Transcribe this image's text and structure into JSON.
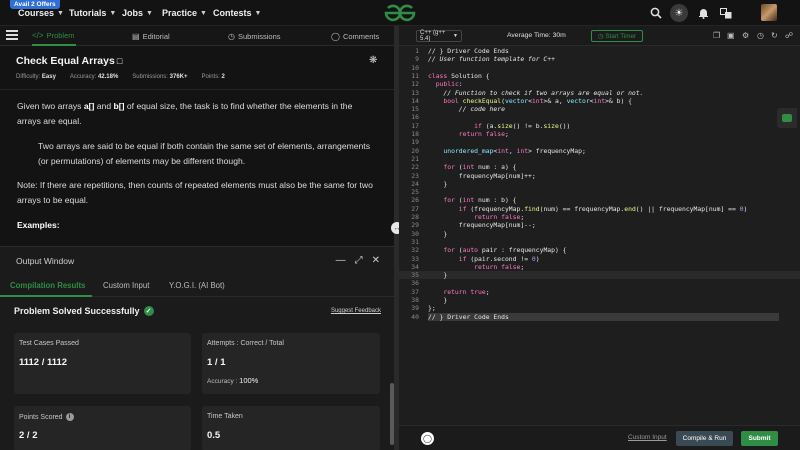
{
  "nav": {
    "offer_badge": "Avail 2 Offers",
    "items": [
      "Courses",
      "Tutorials",
      "Jobs",
      "Practice",
      "Contests"
    ]
  },
  "left_tabs": {
    "problem": "Problem",
    "editorial": "Editorial",
    "submissions": "Submissions",
    "comments": "Comments"
  },
  "problem": {
    "title": "Check Equal Arrays",
    "difficulty_label": "Difficulty:",
    "difficulty": "Easy",
    "accuracy_label": "Accuracy:",
    "accuracy": "42.18%",
    "submissions_label": "Submissions:",
    "submissions": "376K+",
    "points_label": "Points:",
    "points": "2",
    "para1_a": "Given two arrays ",
    "para1_b1": "a[]",
    "para1_c": " and ",
    "para1_b2": "b[]",
    "para1_d": " of equal size, the task is to find whether the elements in the arrays are equal.",
    "para2": "Two arrays are said to be equal if both contain the same set of elements, arrangements (or permutations) of elements may be different though.",
    "para3": "Note: If there are repetitions, then counts of repeated elements must also be the same for two arrays to be equal.",
    "examples": "Examples:"
  },
  "output": {
    "title": "Output Window",
    "tabs": [
      "Compilation Results",
      "Custom Input",
      "Y.O.G.I. (AI Bot)"
    ],
    "status": "Problem Solved Successfully",
    "suggest": "Suggest Feedback",
    "cards": {
      "tests_label": "Test Cases Passed",
      "tests_value": "1112 / 1112",
      "attempts_label": "Attempts : Correct / Total",
      "attempts_value": "1 / 1",
      "accuracy_label": "Accuracy :",
      "accuracy_value": "100%",
      "points_label": "Points Scored",
      "points_value": "2 / 2",
      "time_label": "Time Taken",
      "time_value": "0.5"
    }
  },
  "editor": {
    "language": "C++ (g++ 5.4)",
    "avg_time": "Average Time: 30m",
    "timer": "Start Timer",
    "custom_input": "Custom Input",
    "compile_run": "Compile & Run",
    "submit": "Submit",
    "lines": [
      {
        "n": "1",
        "t": "// } Driver Code Ends",
        "cls": "gray"
      },
      {
        "n": "9",
        "t": "// User function template for C++",
        "cls": "cm"
      },
      {
        "n": "10",
        "t": "",
        "cls": ""
      },
      {
        "n": "11",
        "t": "class Solution {",
        "cls": ""
      },
      {
        "n": "12",
        "t": "  public:",
        "cls": ""
      },
      {
        "n": "13",
        "t": "    // Function to check if two arrays are equal or not.",
        "cls": "cm"
      },
      {
        "n": "14",
        "t": "    bool checkEqual(vector<int>& a, vector<int>& b) {",
        "cls": ""
      },
      {
        "n": "15",
        "t": "        // code here",
        "cls": "cm"
      },
      {
        "n": "16",
        "t": "",
        "cls": ""
      },
      {
        "n": "17",
        "t": "            if (a.size() != b.size())",
        "cls": ""
      },
      {
        "n": "18",
        "t": "        return false;",
        "cls": ""
      },
      {
        "n": "19",
        "t": "",
        "cls": ""
      },
      {
        "n": "20",
        "t": "    unordered_map<int, int> frequencyMap;",
        "cls": ""
      },
      {
        "n": "21",
        "t": "",
        "cls": ""
      },
      {
        "n": "22",
        "t": "    for (int num : a) {",
        "cls": ""
      },
      {
        "n": "23",
        "t": "        frequencyMap[num]++;",
        "cls": ""
      },
      {
        "n": "24",
        "t": "    }",
        "cls": ""
      },
      {
        "n": "25",
        "t": "",
        "cls": ""
      },
      {
        "n": "26",
        "t": "    for (int num : b) {",
        "cls": ""
      },
      {
        "n": "27",
        "t": "        if (frequencyMap.find(num) == frequencyMap.end() || frequencyMap[num] == 0)",
        "cls": ""
      },
      {
        "n": "28",
        "t": "            return false;",
        "cls": ""
      },
      {
        "n": "29",
        "t": "        frequencyMap[num]--;",
        "cls": ""
      },
      {
        "n": "30",
        "t": "    }",
        "cls": ""
      },
      {
        "n": "31",
        "t": "",
        "cls": ""
      },
      {
        "n": "32",
        "t": "    for (auto pair : frequencyMap) {",
        "cls": ""
      },
      {
        "n": "33",
        "t": "        if (pair.second != 0)",
        "cls": ""
      },
      {
        "n": "34",
        "t": "            return false;",
        "cls": ""
      },
      {
        "n": "35",
        "t": "    }",
        "cls": "hl"
      },
      {
        "n": "36",
        "t": "",
        "cls": ""
      },
      {
        "n": "37",
        "t": "    return true;",
        "cls": ""
      },
      {
        "n": "38",
        "t": "    }",
        "cls": ""
      },
      {
        "n": "39",
        "t": "};",
        "cls": ""
      },
      {
        "n": "40",
        "t": "// } Driver Code Ends",
        "cls": "grayfold"
      }
    ]
  },
  "colors": {
    "accent": "#2f8d46",
    "background": "#131313",
    "editor_bg": "#1e1e1e"
  }
}
